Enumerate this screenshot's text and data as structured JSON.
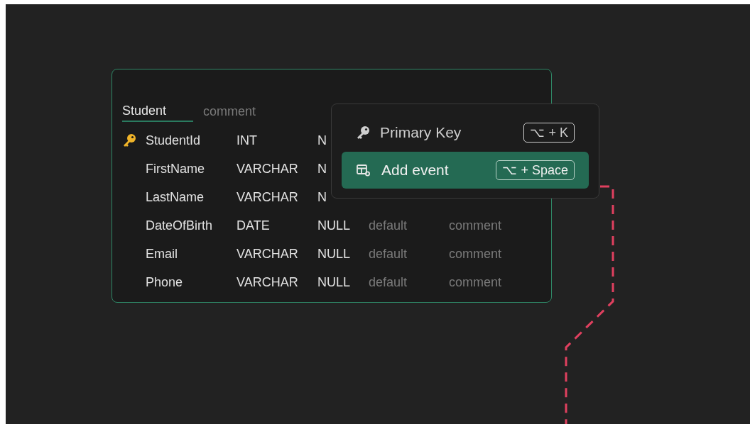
{
  "table": {
    "name": "Student",
    "comment_placeholder": "comment",
    "selected": true,
    "columns": [
      {
        "name": "StudentId",
        "type": "INT",
        "null": "N",
        "primary_key": true
      },
      {
        "name": "FirstName",
        "type": "VARCHAR",
        "null": "N",
        "primary_key": false
      },
      {
        "name": "LastName",
        "type": "VARCHAR",
        "null": "N",
        "primary_key": false
      },
      {
        "name": "DateOfBirth",
        "type": "DATE",
        "null": "NULL",
        "default_placeholder": "default",
        "comment_placeholder": "comment",
        "primary_key": false
      },
      {
        "name": "Email",
        "type": "VARCHAR",
        "null": "NULL",
        "default_placeholder": "default",
        "comment_placeholder": "comment",
        "primary_key": false
      },
      {
        "name": "Phone",
        "type": "VARCHAR",
        "null": "NULL",
        "default_placeholder": "default",
        "comment_placeholder": "comment",
        "primary_key": false
      }
    ]
  },
  "context_menu": {
    "items": [
      {
        "kind": "key",
        "label": "Primary Key",
        "shortcut": "⌥ + K",
        "selected": false
      },
      {
        "kind": "event",
        "label": "Add event",
        "shortcut": "⌥ + Space",
        "selected": true
      }
    ]
  }
}
